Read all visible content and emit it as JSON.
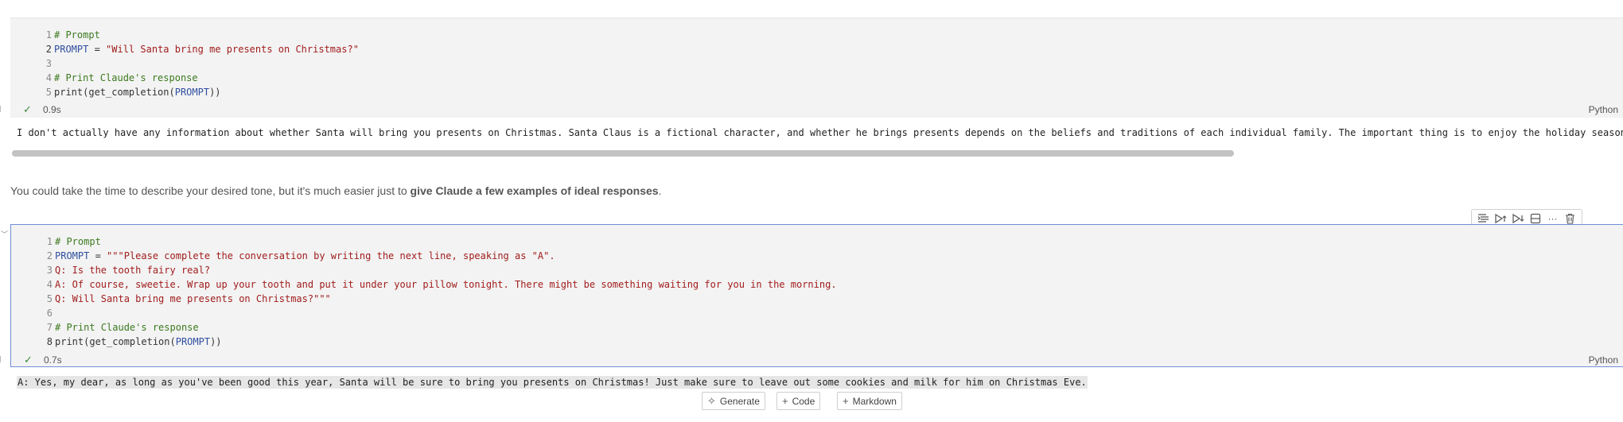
{
  "cell1": {
    "lines": [
      {
        "n": "1",
        "tokens": [
          {
            "t": "# Prompt",
            "c": "comment"
          }
        ]
      },
      {
        "n": "2",
        "active": true,
        "tokens": [
          {
            "t": "PROMPT",
            "c": "var"
          },
          {
            "t": " = ",
            "c": "plain"
          },
          {
            "t": "\"Will Santa bring me presents on Christmas?\"",
            "c": "str"
          }
        ]
      },
      {
        "n": "3",
        "tokens": []
      },
      {
        "n": "4",
        "tokens": [
          {
            "t": "# Print Claude's response",
            "c": "comment"
          }
        ]
      },
      {
        "n": "5",
        "tokens": [
          {
            "t": "print(get_completion(",
            "c": "plain"
          },
          {
            "t": "PROMPT",
            "c": "var"
          },
          {
            "t": "))",
            "c": "plain"
          }
        ]
      }
    ],
    "time": "0.9s",
    "language": "Python",
    "output": "I don't actually have any information about whether Santa will bring you presents on Christmas. Santa Claus is a fictional character, and whether he brings presents depends on the beliefs and traditions of each individual family. The important thing is to enjoy the holiday season"
  },
  "markdown": {
    "prefix": "You could take the time to describe your desired tone, but it's much easier just to ",
    "bold": "give Claude a few examples of ideal responses",
    "suffix": "."
  },
  "cell2": {
    "lines": [
      {
        "n": "1",
        "tokens": [
          {
            "t": "# Prompt",
            "c": "comment"
          }
        ]
      },
      {
        "n": "2",
        "tokens": [
          {
            "t": "PROMPT",
            "c": "var"
          },
          {
            "t": " = ",
            "c": "plain"
          },
          {
            "t": "\"\"\"Please complete the conversation by writing the next line, speaking as \"A\".",
            "c": "str"
          }
        ]
      },
      {
        "n": "3",
        "tokens": [
          {
            "t": "Q: Is the tooth fairy real?",
            "c": "str"
          }
        ]
      },
      {
        "n": "4",
        "tokens": [
          {
            "t": "A: Of course, sweetie. Wrap up your tooth and put it under your pillow tonight. There might be something waiting for you in the morning.",
            "c": "str"
          }
        ]
      },
      {
        "n": "5",
        "tokens": [
          {
            "t": "Q: Will Santa bring me presents on Christmas?\"\"\"",
            "c": "str"
          }
        ]
      },
      {
        "n": "6",
        "tokens": []
      },
      {
        "n": "7",
        "tokens": [
          {
            "t": "# Print Claude's response",
            "c": "comment"
          }
        ]
      },
      {
        "n": "8",
        "active": true,
        "tokens": [
          {
            "t": "print(get_completion(",
            "c": "plain"
          },
          {
            "t": "PROMPT",
            "c": "var"
          },
          {
            "t": "))",
            "c": "plain"
          }
        ]
      }
    ],
    "time": "0.7s",
    "language": "Python",
    "output": "A: Yes, my dear, as long as you've been good this year, Santa will be sure to bring you presents on Christmas! Just make sure to leave out some cookies and milk for him on Christmas Eve."
  },
  "add_buttons": {
    "generate": "Generate",
    "code": "Code",
    "markdown": "Markdown"
  },
  "icons": {
    "check": "check-icon",
    "chevron": "chevron-down-icon"
  },
  "colors": {
    "comment": "#3c7a1e",
    "variable": "#2f4fa0",
    "string": "#a11d1d",
    "active_border": "#6f8fd8"
  }
}
